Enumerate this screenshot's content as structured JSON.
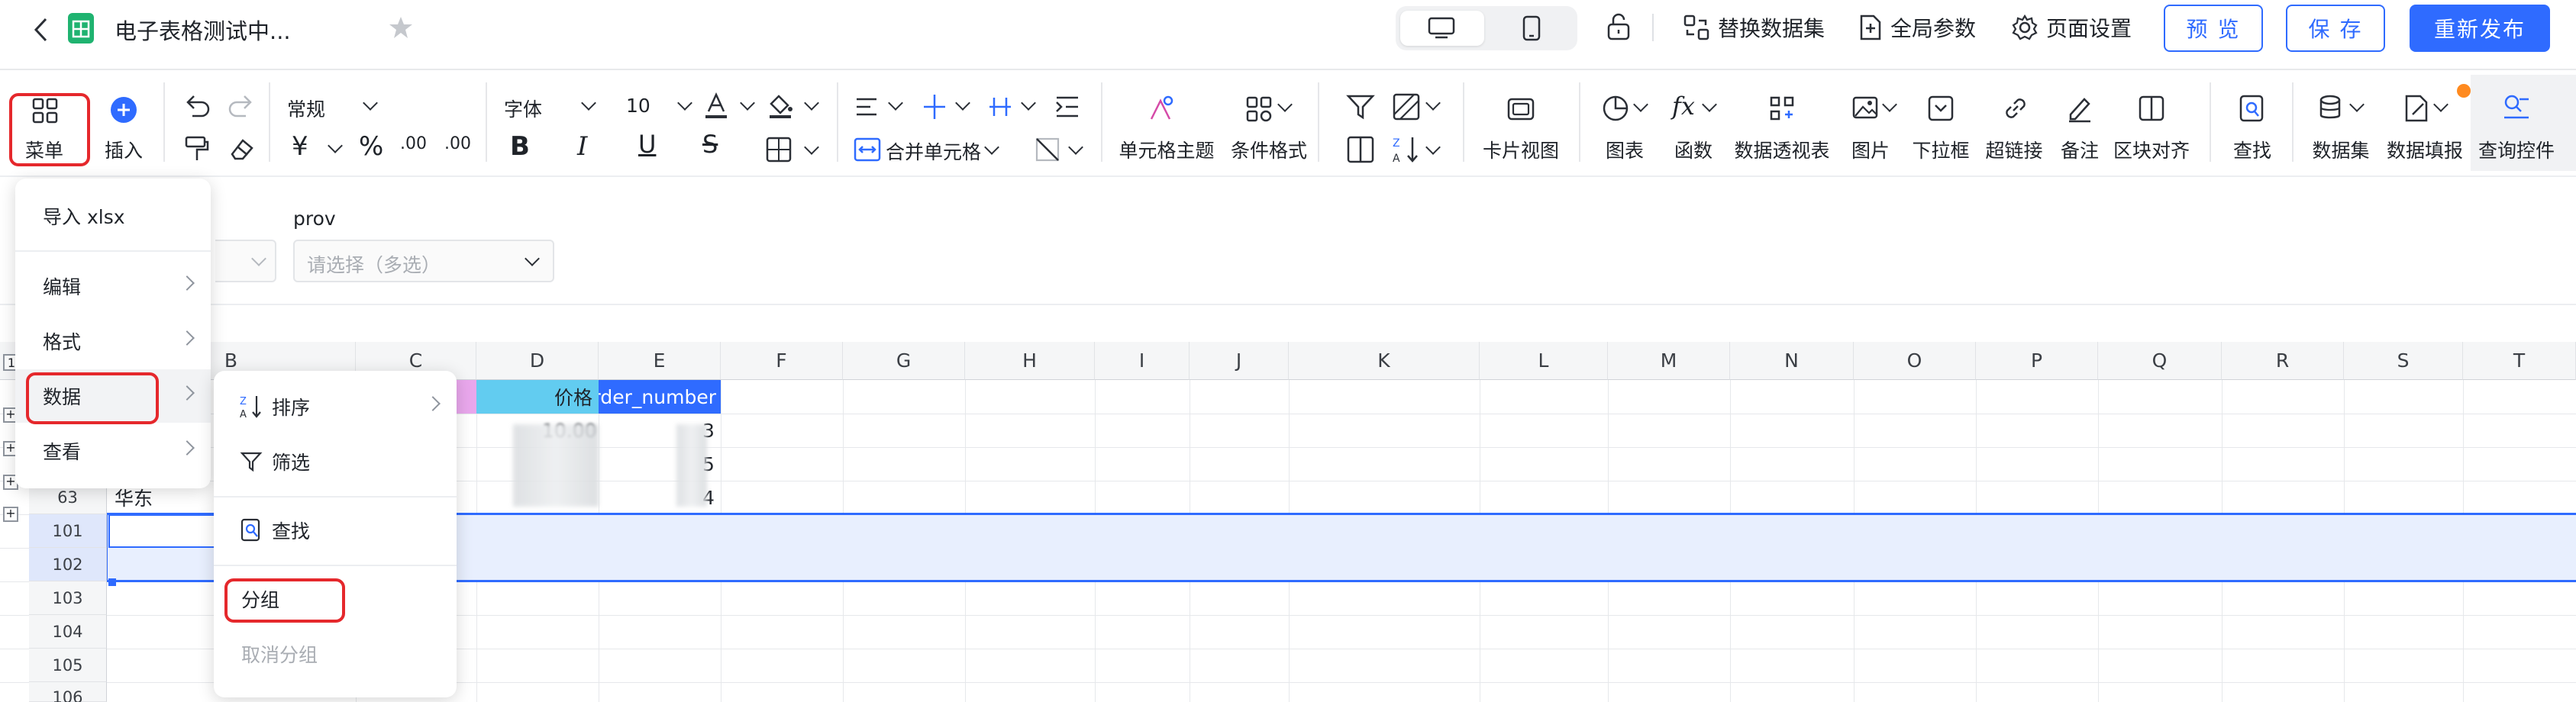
{
  "header": {
    "title": "电子表格测试中...",
    "actions": [
      "替换数据集",
      "全局参数",
      "页面设置"
    ],
    "buttons": {
      "preview": "预 览",
      "save": "保 存",
      "publish": "重新发布"
    }
  },
  "toolbar": {
    "menu": "菜单",
    "insert": "插入",
    "format_select": "常规",
    "font_select": "字体",
    "font_size": "10",
    "merge_cells": "合并单元格",
    "cell_theme": "单元格主题",
    "cond_format": "条件格式",
    "card_view": "卡片视图",
    "chart": "图表",
    "function": "函数",
    "pivot": "数据透视表",
    "image": "图片",
    "dropdown": "下拉框",
    "hyperlink": "超链接",
    "note": "备注",
    "align_block": "区块对齐",
    "find": "查找",
    "dataset": "数据集",
    "data_fill": "数据填报",
    "query_control": "查询控件"
  },
  "filter": {
    "label": "prov",
    "placeholder": "请选择（多选）"
  },
  "sheet": {
    "columns": [
      "B",
      "C",
      "D",
      "E",
      "F",
      "G",
      "H",
      "I",
      "J",
      "K",
      "L",
      "M",
      "N",
      "O",
      "P",
      "Q",
      "R",
      "S",
      "T"
    ],
    "row_numbers": [
      "63",
      "101",
      "102",
      "103",
      "104",
      "105",
      "106"
    ],
    "header_cells": {
      "price": "价格",
      "order_number": "rder_number"
    },
    "cell_values": {
      "region": "华东",
      "price_partial": "10.00",
      "e1": "3",
      "e2": "5",
      "e3": "4"
    }
  },
  "main_menu": {
    "items": [
      "导入 xlsx",
      "编辑",
      "格式",
      "数据",
      "查看"
    ]
  },
  "data_submenu": {
    "items": [
      "排序",
      "筛选",
      "查找",
      "分组",
      "取消分组"
    ]
  },
  "colors": {
    "accent": "#2f6bff",
    "highlight": "#e5282c",
    "selection": "#e8effe",
    "badge": "#ff8a1f"
  }
}
